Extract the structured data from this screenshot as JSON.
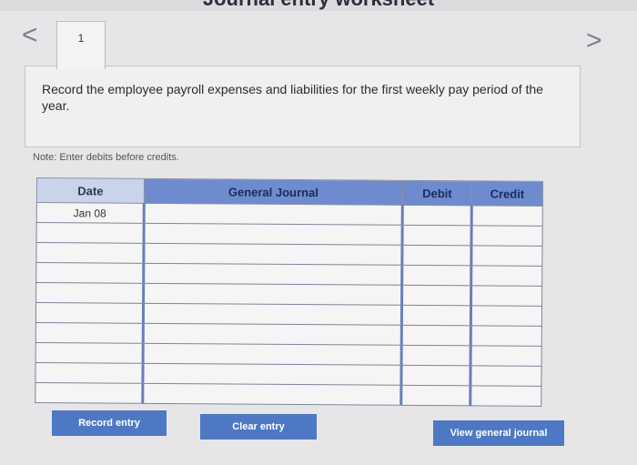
{
  "page": {
    "header_partial": "Journal entry worksheet"
  },
  "nav": {
    "prev": "<",
    "next": ">"
  },
  "tab": {
    "number": "1"
  },
  "question": {
    "text": "Record the employee payroll expenses and liabilities for the first weekly pay period of the year."
  },
  "note": "Note: Enter debits before credits.",
  "journal": {
    "headers": {
      "date": "Date",
      "account": "General Journal",
      "debit": "Debit",
      "credit": "Credit"
    },
    "rows": [
      {
        "date": "Jan 08",
        "account": "",
        "debit": "",
        "credit": ""
      },
      {
        "date": "",
        "account": "",
        "debit": "",
        "credit": ""
      },
      {
        "date": "",
        "account": "",
        "debit": "",
        "credit": ""
      },
      {
        "date": "",
        "account": "",
        "debit": "",
        "credit": ""
      },
      {
        "date": "",
        "account": "",
        "debit": "",
        "credit": ""
      },
      {
        "date": "",
        "account": "",
        "debit": "",
        "credit": ""
      },
      {
        "date": "",
        "account": "",
        "debit": "",
        "credit": ""
      },
      {
        "date": "",
        "account": "",
        "debit": "",
        "credit": ""
      },
      {
        "date": "",
        "account": "",
        "debit": "",
        "credit": ""
      },
      {
        "date": "",
        "account": "",
        "debit": "",
        "credit": ""
      }
    ]
  },
  "buttons": {
    "record": "Record entry",
    "clear": "Clear entry",
    "view": "View general journal"
  },
  "colors": {
    "button": "#4f78c4",
    "header": "#6e8bd0"
  }
}
